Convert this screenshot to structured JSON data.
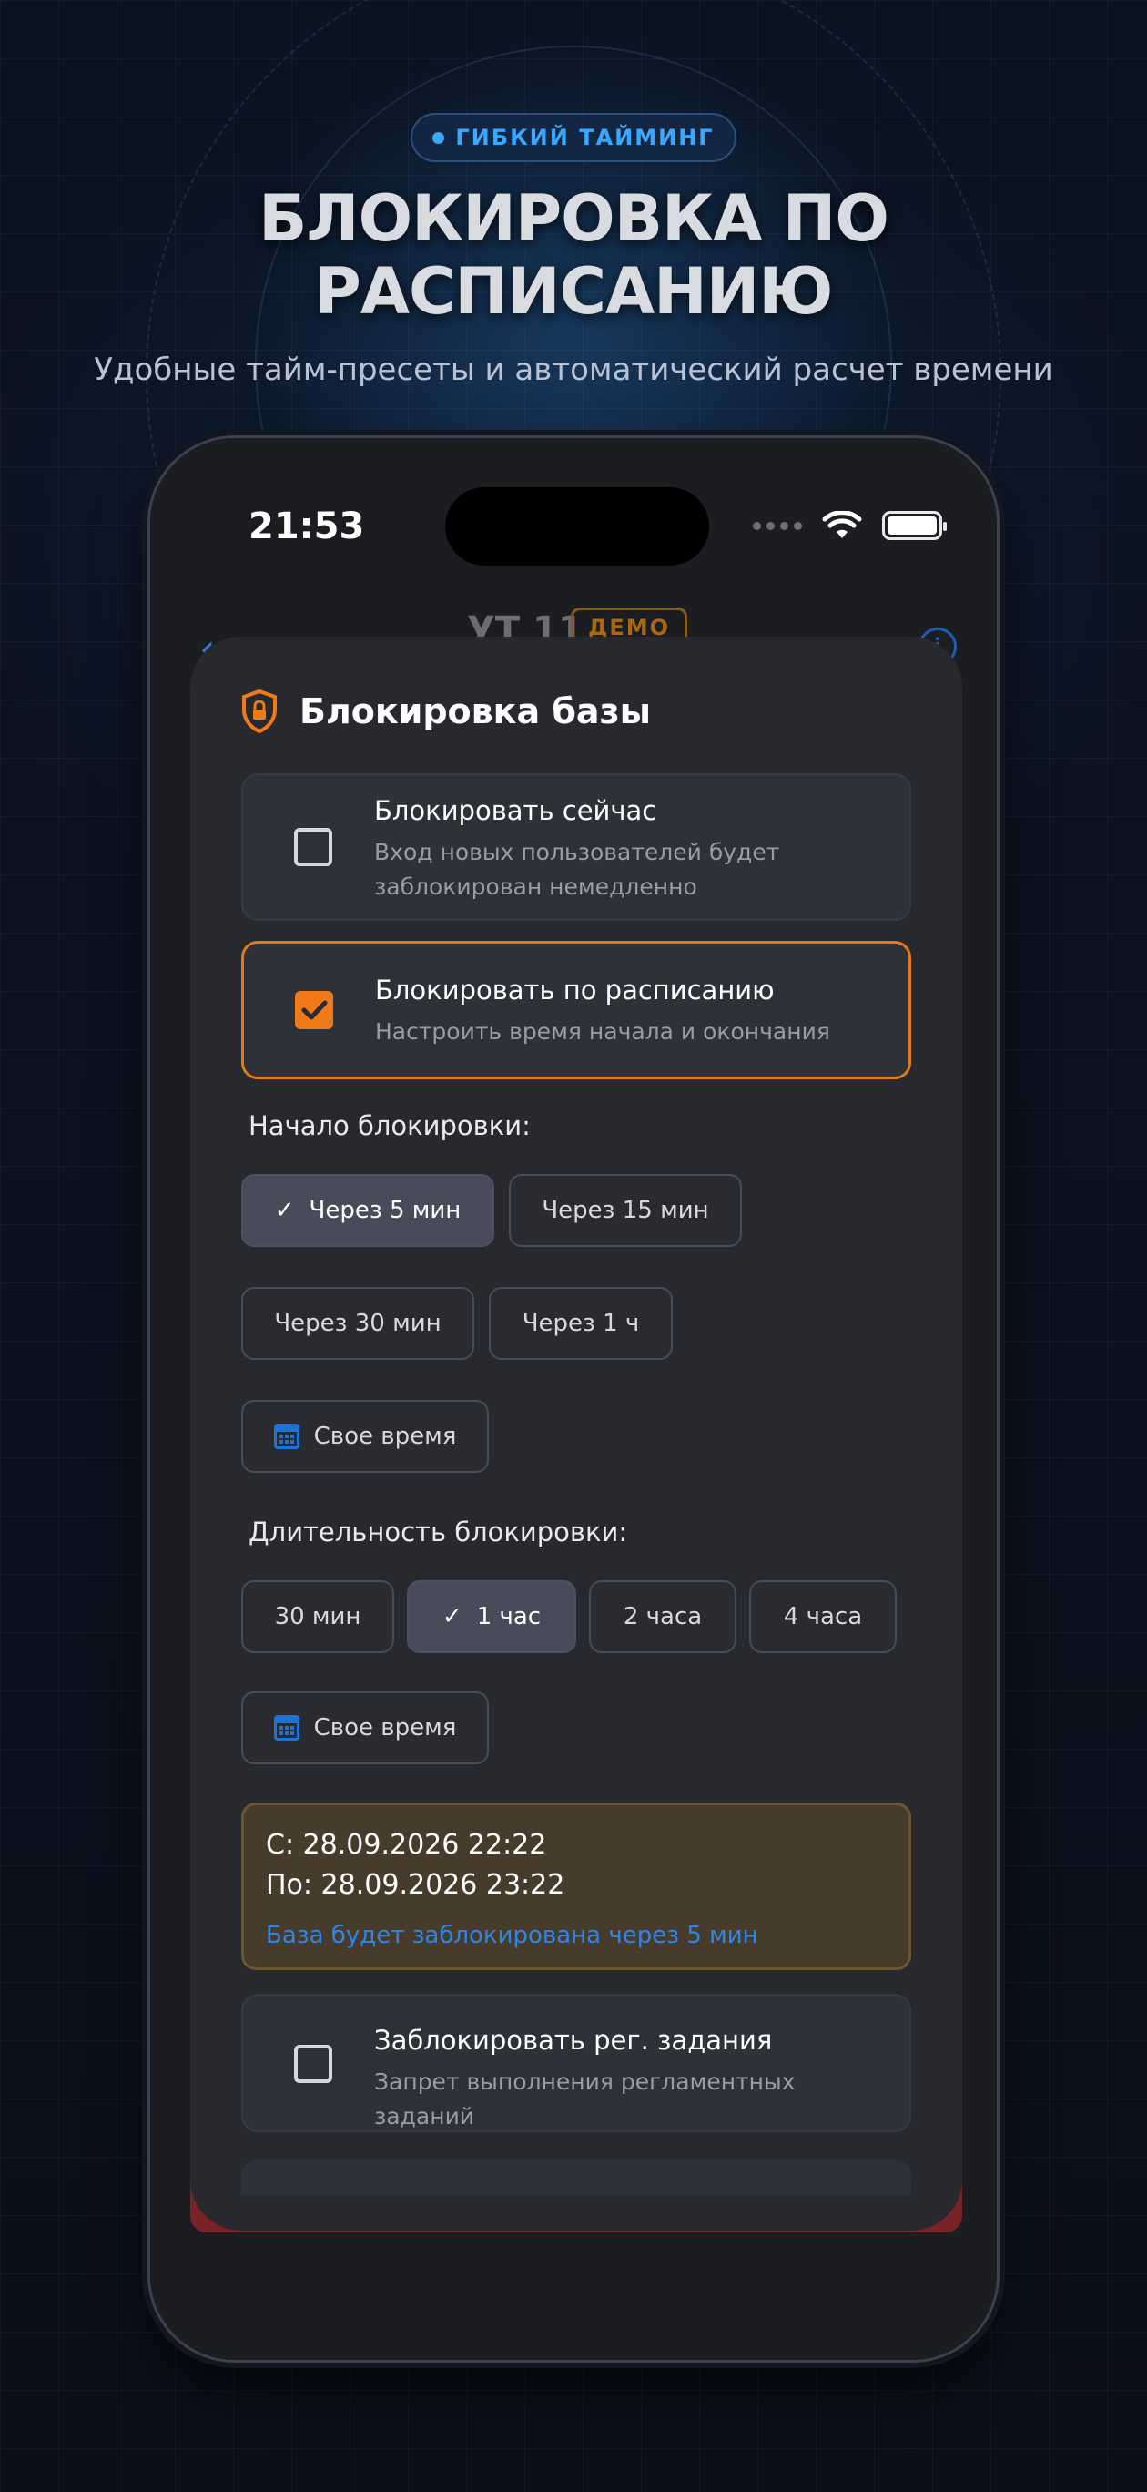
{
  "promo": {
    "badge": "ГИБКИЙ ТАЙМИНГ",
    "headline_line1": "БЛОКИРОВКА ПО",
    "headline_line2": "РАСПИСАНИЮ",
    "subhead": "Удобные тайм-пресеты и автоматический расчет времени"
  },
  "status_bar": {
    "time": "21:53"
  },
  "nav": {
    "title": "УТ 11",
    "demo_badge": "ДЕМО"
  },
  "sheet": {
    "title": "Блокировка базы",
    "option_now": {
      "title": "Блокировать сейчас",
      "description": "Вход новых пользователей будет заблокирован немедленно",
      "checked": false
    },
    "option_schedule": {
      "title": "Блокировать по расписанию",
      "description": "Настроить время начала и окончания",
      "checked": true
    },
    "start": {
      "label": "Начало блокировки:",
      "presets": [
        "Через 5 мин",
        "Через 15 мин",
        "Через 30 мин",
        "Через 1 ч"
      ],
      "selected": "Через 5 мин",
      "custom": "Свое время"
    },
    "duration": {
      "label": "Длительность блокировки:",
      "presets": [
        "30 мин",
        "1 час",
        "2 часа",
        "4 часа"
      ],
      "selected": "1 час",
      "custom": "Свое время"
    },
    "summary": {
      "from": "С: 28.09.2026 22:22",
      "to": "По: 28.09.2026 23:22",
      "note": "База будет заблокирована через 5 мин"
    },
    "option_jobs": {
      "title": "Заблокировать рег. задания",
      "description": "Запрет выполнения регламентных заданий",
      "checked": false
    }
  },
  "colors": {
    "accent_orange": "#f07a17",
    "accent_blue": "#2f86e8",
    "badge_blue": "#3aa8ff"
  }
}
